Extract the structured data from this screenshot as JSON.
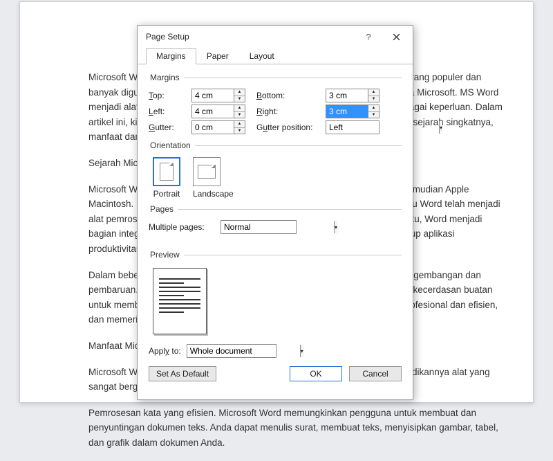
{
  "doc": {
    "p1": "Microsoft Word, sering disebut sebagai MS Word, adalah salah satu program yang populer dan banyak digunakan di dunia. Dikembangkan oleh perusahaan teknologi raksasa Microsoft. MS Word menjadi alat penting bagi individu, bisnis, dan lembaga pendidikan untuk berbagai keperluan. Dalam artikel ini, kita akan menjelajahi lebih dalam tentang Microsoft Word, termasuk sejarah singkatnya, manfaat dan fitur-fitur terbaru.",
    "p2": "Sejarah Microsoft Word",
    "p3": "Microsoft Word pertama kali dirilis pada tahun 1983 untuk sistem Xenix dan kemudian Apple Macintosh. Pada tahun 1989, versi Windows pertama diluncurkan, dan sejak itu Word telah menjadi alat pemrosesan kata yang dominan di seluruh dunia. Seiring berjalannya waktu, Word menjadi bagian integral dari paket perangkat lunak Microsoft Office, yang juga mencakup aplikasi produktivitas lainnya seperti Excel, PowerPoint, dan Outlook.",
    "p4": "Dalam beberapa tahun terakhir, Microsoft Word telah mengalami sejumlah pengembangan dan pembaruan. Versi terbaru seperti Microsoft Word 2021, bahkan menggunakan kecerdasan buatan untuk membantu pengguna dalam menulis, menyusun dokumen yang lebih profesional dan efisien, dan memeriksa ejaan, dan tata bahasa.",
    "p5": "Manfaat Microsoft Word",
    "p6": "Microsoft Word memiliki sejumlah manfaat atau kegunaan penting yang menjadikannya alat yang sangat berguna dalam berbagai konteks. Berikut manfaat utama:",
    "p7": "Pemrosesan kata yang efisien. Microsoft Word memungkinkan pengguna untuk membuat dan penyuntingan dokumen teks. Anda dapat menulis surat, membuat teks, menyisipkan gambar, tabel, dan grafik dalam dokumen Anda."
  },
  "dialog": {
    "title": "Page Setup",
    "tabs": {
      "margins": "Margins",
      "paper": "Paper",
      "layout": "Layout"
    },
    "margins": {
      "legend": "Margins",
      "top_lbl": "Top:",
      "top_val": "4 cm",
      "bottom_lbl": "Bottom:",
      "bottom_val": "3 cm",
      "left_lbl": "Left:",
      "left_val": "4 cm",
      "right_lbl": "Right:",
      "right_val": "3 cm",
      "gutter_lbl": "Gutter:",
      "gutter_val": "0 cm",
      "gutterpos_lbl": "Gutter position:",
      "gutterpos_val": "Left"
    },
    "orientation": {
      "legend": "Orientation",
      "portrait": "Portrait",
      "landscape": "Landscape"
    },
    "pages": {
      "legend": "Pages",
      "multi_lbl": "Multiple pages:",
      "multi_val": "Normal"
    },
    "preview": {
      "legend": "Preview"
    },
    "apply": {
      "lbl": "Apply to:",
      "val": "Whole document"
    },
    "buttons": {
      "setdefault": "Set As Default",
      "ok": "OK",
      "cancel": "Cancel"
    }
  }
}
